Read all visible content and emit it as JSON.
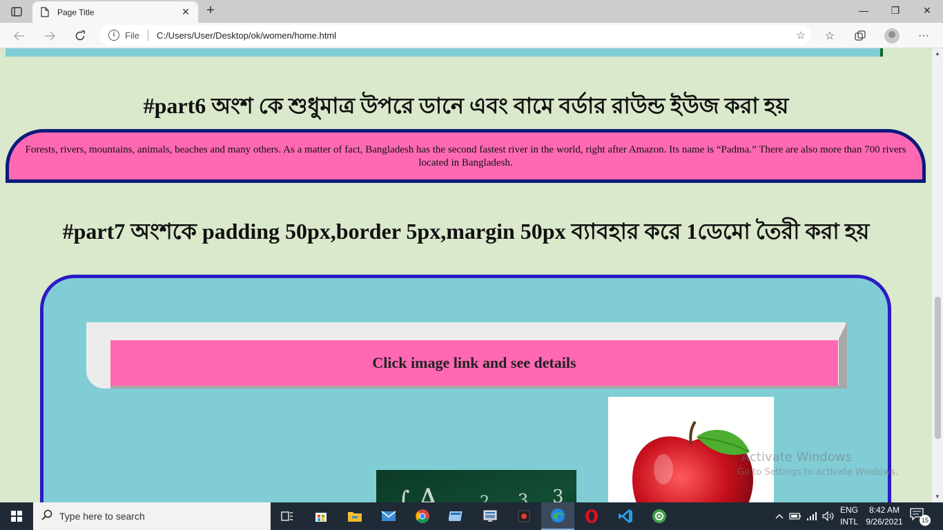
{
  "browser": {
    "tab_title": "Page Title",
    "tab_close": "✕",
    "new_tab": "+",
    "address_prefix": "File",
    "url": "C:/Users/User/Desktop/ok/women/home.html"
  },
  "window_controls": {
    "minimize": "—",
    "restore": "❐",
    "close": "✕"
  },
  "page": {
    "part6_heading": "#part6 অংশ কে শুধুমাত্র উপরে ডানে এবং বামে বর্ডার রাউন্ড ইউজ করা হয়",
    "part6_text": "Forests, rivers, mountains, animals, beaches and many others. As a matter of fact, Bangladesh has the second fastest river in the world, right after Amazon. Its name is “Padma.” There are also more than 700 rivers located in Bangladesh.",
    "part7_heading": "#part7 অংশকে padding 50px,border 5px,margin 50px ব্যাবহার করে 1ডেমো তৈরী করা হয়",
    "banner_text": "Click image link and see details"
  },
  "watermark": {
    "title": "Activate Windows",
    "subtitle": "Go to Settings to activate Windows."
  },
  "taskbar": {
    "search_placeholder": "Type here to search",
    "language_top": "ENG",
    "language_bottom": "INTL",
    "time": "8:42 AM",
    "date": "9/26/2021",
    "notification_count": "15"
  }
}
